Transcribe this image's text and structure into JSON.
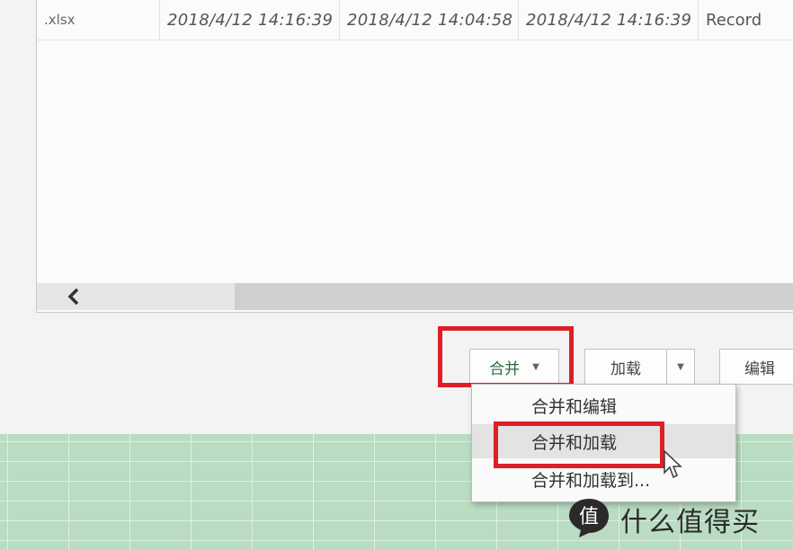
{
  "table": {
    "row": {
      "extension": ".xlsx",
      "date_accessed": "2018/4/12 14:16:39",
      "date_modified": "2018/4/12 14:04:58",
      "date_created": "2018/4/12 14:16:39",
      "attributes": "Record"
    }
  },
  "scrollbar": {
    "left_arrow_icon": "chevron-left-icon"
  },
  "buttons": {
    "merge_label": "合并",
    "merge_caret_icon": "caret-down-icon",
    "load_label": "加载",
    "load_caret_icon": "caret-down-icon",
    "edit_label": "编辑"
  },
  "menu": {
    "items": [
      {
        "label": "合并和编辑"
      },
      {
        "label": "合并和加载"
      },
      {
        "label": "合并和加载到..."
      }
    ]
  },
  "highlight_color": "#dd1f26",
  "watermark": {
    "text": "什么值得买",
    "badge_char": "值"
  }
}
